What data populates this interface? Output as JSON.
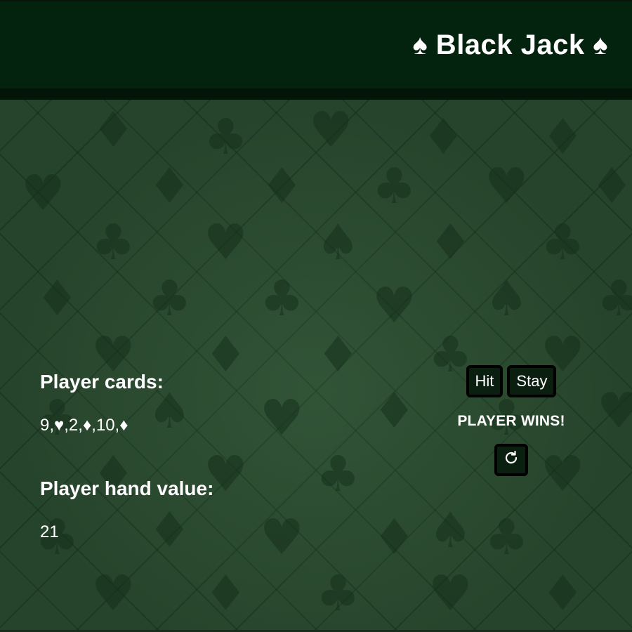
{
  "header": {
    "title": "♠ Black Jack ♠"
  },
  "player": {
    "cards_label": "Player cards:",
    "cards_value": "9,♥,2,♦,10,♦",
    "hand_label": "Player hand value:",
    "hand_value": "21"
  },
  "controls": {
    "hit_label": "Hit",
    "stay_label": "Stay",
    "result_text": "PLAYER WINS!",
    "reset_icon": "refresh-icon"
  },
  "colors": {
    "header_bg": "#03230f",
    "felt_bg": "#2c4b31",
    "button_bg": "#0b1f10",
    "text": "#ffffff"
  }
}
